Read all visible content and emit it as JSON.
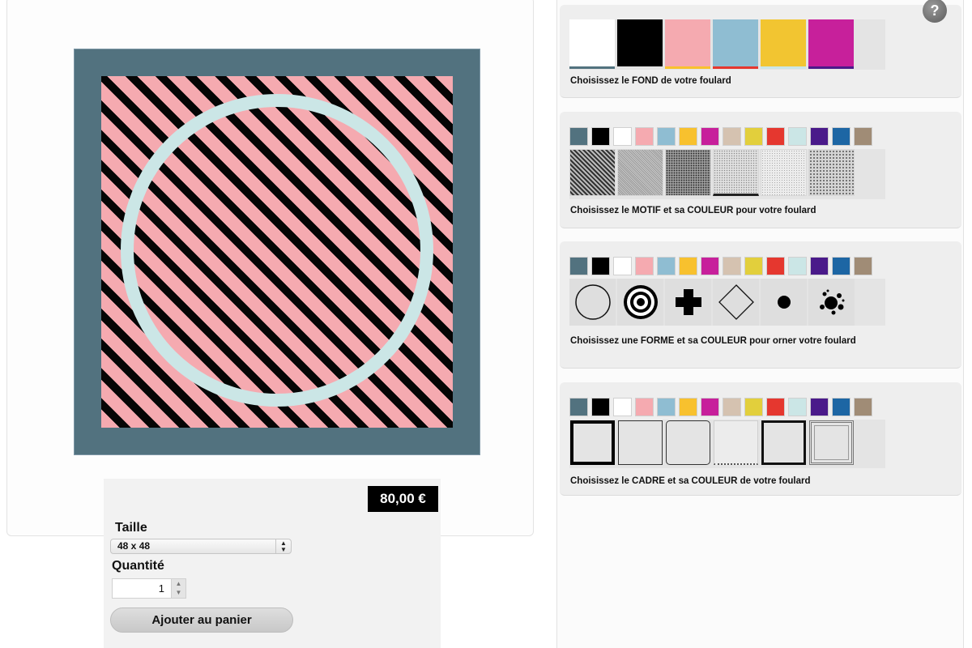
{
  "preview": {
    "frame_color": "#52727f",
    "background_color": "#f5aab0",
    "motif_color": "#050505",
    "shape_color": "#cbe6e6"
  },
  "purchase": {
    "price": "80,00 €",
    "size_label": "Taille",
    "size_value": "48 x 48",
    "quantity_label": "Quantité",
    "quantity_value": "1",
    "add_to_cart": "Ajouter au panier"
  },
  "help": {
    "icon": "question-icon",
    "label": "?"
  },
  "palette": [
    "#52727f",
    "#000000",
    "#ffffff",
    "#f5aab0",
    "#8fbdd2",
    "#f8c12e",
    "#c7209b",
    "#d5c2b0",
    "#e2cf3c",
    "#e5372f",
    "#cbe6e6",
    "#4a1a8a",
    "#1d66a4",
    "#a08c76"
  ],
  "fond": {
    "caption": "Choisissez le FOND de votre foulard",
    "swatches": [
      {
        "color": "#ffffff",
        "bar": "#52727f"
      },
      {
        "color": "#000000",
        "bar": "#e4e4e4"
      },
      {
        "color": "#f5aab0",
        "bar": "#f8c12e"
      },
      {
        "color": "#8fbdd2",
        "bar": "#e5372f"
      },
      {
        "color": "#f2c531",
        "bar": "#cbe6e6"
      },
      {
        "color": "#c7209b",
        "bar": "#4a1a8a"
      }
    ]
  },
  "motif": {
    "caption": "Choisissez le MOTIF et sa COULEUR pour votre foulard",
    "patterns": [
      "diagonal-stripes",
      "fine-hatch",
      "dense-dots",
      "light-dots",
      "very-fine-dots",
      "checker-dots"
    ],
    "selected": 0
  },
  "forme": {
    "caption": "Choisissez une FORME et sa COULEUR pour orner votre foulard",
    "shapes": [
      "circle-outline-icon",
      "target-icon",
      "cross-icon",
      "diamond-outline-icon",
      "dot-icon",
      "splatter-icon"
    ]
  },
  "cadre": {
    "caption": "Choisissez le CADRE et sa COULEUR de votre foulard",
    "frames": [
      "thick-frame",
      "thin-frame",
      "rounded-frame",
      "dotted-frame",
      "medium-frame",
      "double-frame"
    ]
  }
}
